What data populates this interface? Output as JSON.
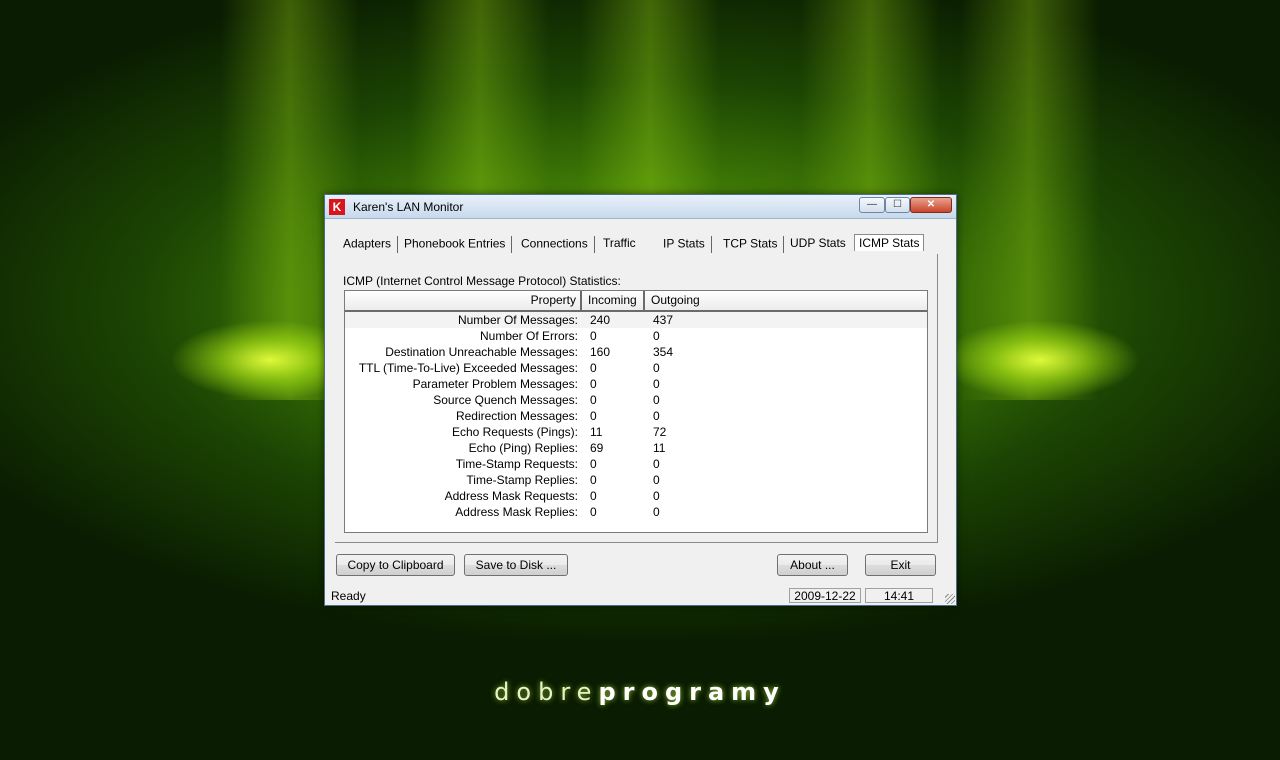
{
  "window": {
    "title": "Karen's LAN Monitor",
    "icon_letter": "K",
    "min_glyph": "—",
    "max_glyph": "☐",
    "close_glyph": "✕"
  },
  "tabs": [
    {
      "label": "Adapters"
    },
    {
      "label": "Phonebook Entries"
    },
    {
      "label": "Connections"
    },
    {
      "label": "Traffic"
    },
    {
      "label": "IP Stats"
    },
    {
      "label": "TCP Stats"
    },
    {
      "label": "UDP Stats"
    },
    {
      "label": "ICMP Stats",
      "active": true
    }
  ],
  "panel_title": "ICMP (Internet Control Message Protocol) Statistics:",
  "table": {
    "headers": {
      "property": "Property",
      "incoming": "Incoming",
      "outgoing": "Outgoing"
    },
    "rows": [
      {
        "property": "Number Of Messages:",
        "incoming": "240",
        "outgoing": "437"
      },
      {
        "property": "Number Of Errors:",
        "incoming": "0",
        "outgoing": "0"
      },
      {
        "property": "Destination Unreachable Messages:",
        "incoming": "160",
        "outgoing": "354"
      },
      {
        "property": "TTL (Time-To-Live) Exceeded Messages:",
        "incoming": "0",
        "outgoing": "0"
      },
      {
        "property": "Parameter Problem Messages:",
        "incoming": "0",
        "outgoing": "0"
      },
      {
        "property": "Source Quench Messages:",
        "incoming": "0",
        "outgoing": "0"
      },
      {
        "property": "Redirection Messages:",
        "incoming": "0",
        "outgoing": "0"
      },
      {
        "property": "Echo Requests (Pings):",
        "incoming": "11",
        "outgoing": "72"
      },
      {
        "property": "Echo (Ping) Replies:",
        "incoming": "69",
        "outgoing": "11"
      },
      {
        "property": "Time-Stamp Requests:",
        "incoming": "0",
        "outgoing": "0"
      },
      {
        "property": "Time-Stamp Replies:",
        "incoming": "0",
        "outgoing": "0"
      },
      {
        "property": "Address Mask Requests:",
        "incoming": "0",
        "outgoing": "0"
      },
      {
        "property": "Address Mask Replies:",
        "incoming": "0",
        "outgoing": "0"
      }
    ]
  },
  "buttons": {
    "copy": "Copy to Clipboard",
    "save": "Save to Disk ...",
    "about": "About ...",
    "exit": "Exit"
  },
  "status": {
    "text": "Ready",
    "date": "2009-12-22",
    "time": "14:41"
  },
  "brand": {
    "light": "dobre",
    "bold": "programy"
  },
  "colors": {
    "accent_red": "#d8151b",
    "background_green": "#4a8a08"
  }
}
